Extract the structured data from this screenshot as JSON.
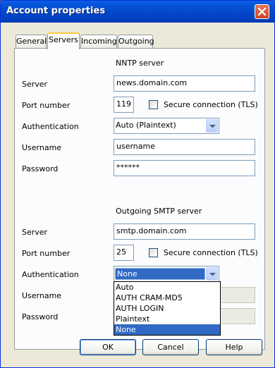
{
  "window": {
    "title": "Account properties"
  },
  "tabs": [
    {
      "label": "General"
    },
    {
      "label": "Servers"
    },
    {
      "label": "Incoming"
    },
    {
      "label": "Outgoing"
    }
  ],
  "nntp": {
    "heading": "NNTP server",
    "server_label": "Server",
    "server_value": "news.domain.com",
    "port_label": "Port number",
    "port_value": "119",
    "tls_label": "Secure connection (TLS)",
    "tls_checked": false,
    "auth_label": "Authentication",
    "auth_value": "Auto  (Plaintext)",
    "username_label": "Username",
    "username_value": "username",
    "password_label": "Password",
    "password_value": "******"
  },
  "smtp": {
    "heading": "Outgoing SMTP server",
    "server_label": "Server",
    "server_value": "smtp.domain.com",
    "port_label": "Port number",
    "port_value": "25",
    "tls_label": "Secure connection (TLS)",
    "tls_checked": false,
    "auth_label": "Authentication",
    "auth_value": "None",
    "auth_options": [
      "Auto",
      "AUTH CRAM-MD5",
      "AUTH LOGIN",
      "Plaintext",
      "None"
    ],
    "auth_selected_option": "None",
    "username_label": "Username",
    "password_label": "Password"
  },
  "buttons": {
    "ok": "OK",
    "cancel": "Cancel",
    "help": "Help"
  },
  "colors": {
    "titlebar": "#0054e3",
    "selection": "#316ac5",
    "face": "#ece9d8",
    "tab_highlight": "#ffc83c"
  }
}
